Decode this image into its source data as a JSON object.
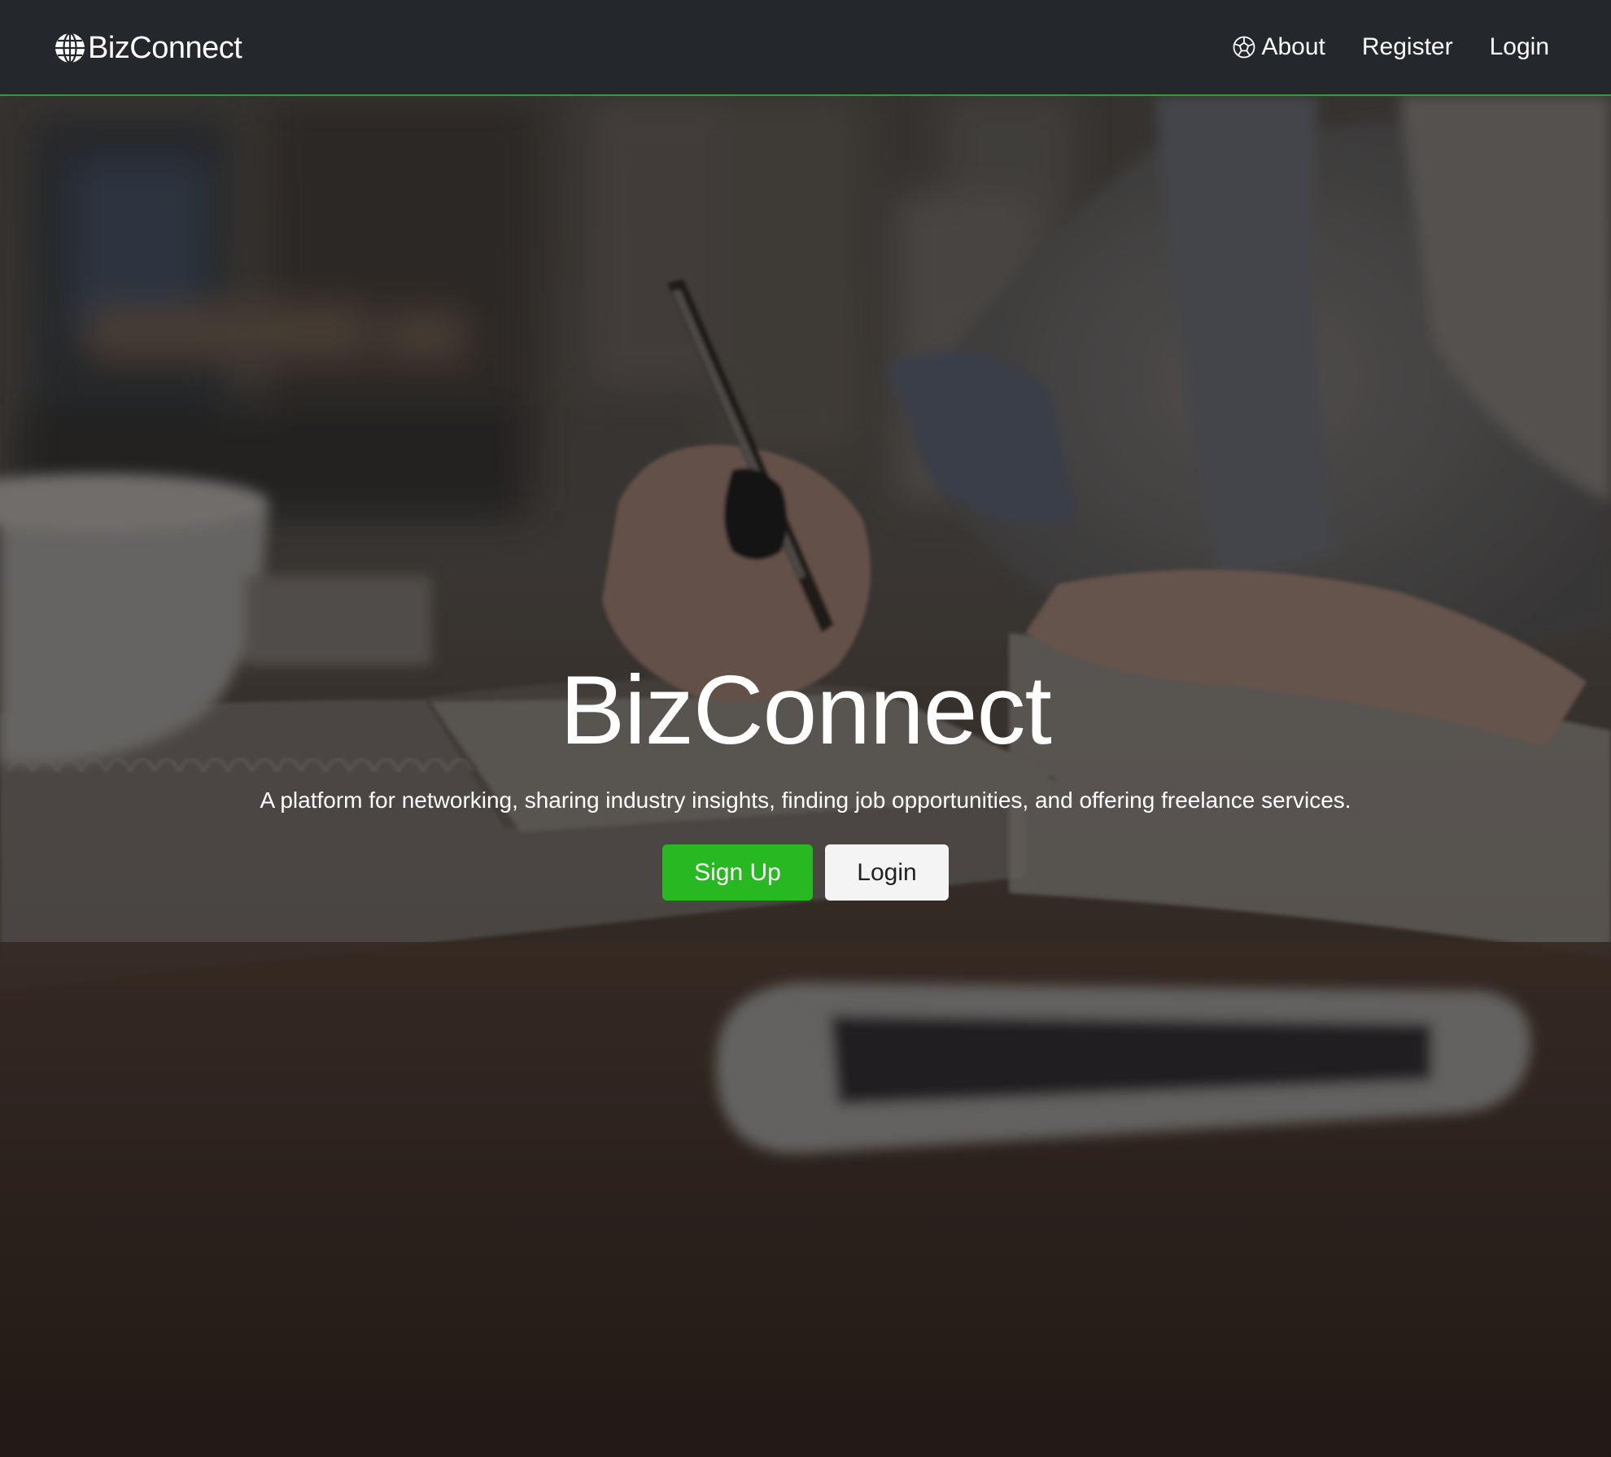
{
  "navbar": {
    "brand": {
      "icon": "globe-icon",
      "label": "BizConnect"
    },
    "links": [
      {
        "label": "About",
        "icon": "soccer-ball-icon"
      },
      {
        "label": "Register"
      },
      {
        "label": "Login"
      }
    ],
    "accent_color": "#2f9e2a",
    "background_color": "#24272c"
  },
  "hero": {
    "title": "BizConnect",
    "subtitle": "A platform for networking, sharing industry insights, finding job opportunities, and offering freelance services.",
    "buttons": {
      "primary_label": "Sign Up",
      "secondary_label": "Login"
    },
    "primary_color": "#27b822"
  }
}
